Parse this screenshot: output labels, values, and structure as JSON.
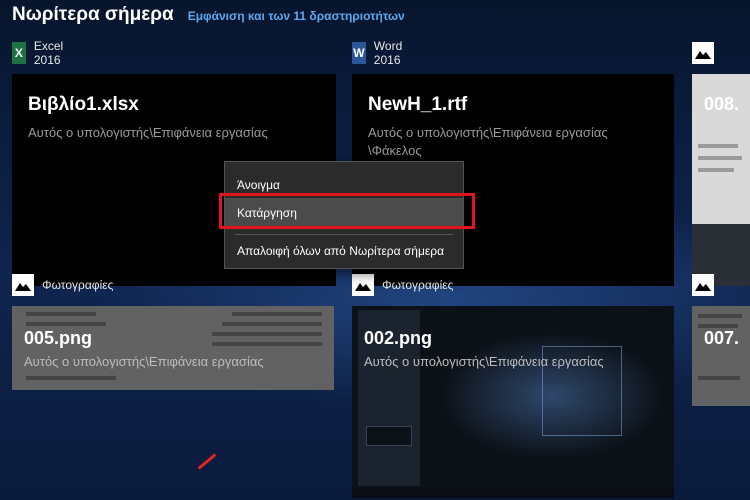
{
  "header": {
    "title": "Νωρίτερα σήμερα",
    "link": "Εμφάνιση και των 11 δραστηριοτήτων"
  },
  "cards": [
    {
      "app": "Excel 2016",
      "app_icon": "excel-icon",
      "title": "Βιβλίο1.xlsx",
      "path": "Αυτός ο υπολογιστής\\Επιφάνεια εργασίας"
    },
    {
      "app": "Word 2016",
      "app_icon": "word-icon",
      "title": "NewH_1.rtf",
      "path_line1": "Αυτός ο υπολογιστής\\Επιφάνεια εργασίας",
      "path_line2": "\\Φάκελος"
    },
    {
      "app": "",
      "app_icon": "photos-icon",
      "title": "008.",
      "path": ""
    },
    {
      "app": "Φωτογραφίες",
      "app_icon": "photos-icon",
      "title": "005.png",
      "path": "Αυτός ο υπολογιστής\\Επιφάνεια εργασίας"
    },
    {
      "app": "Φωτογραφίες",
      "app_icon": "photos-icon",
      "title": "002.png",
      "path": "Αυτός ο υπολογιστής\\Επιφάνεια εργασίας"
    },
    {
      "app": "",
      "app_icon": "photos-icon",
      "title": "007.",
      "path": ""
    }
  ],
  "context_menu": {
    "items": [
      "Άνοιγμα",
      "Κατάργηση",
      "Απαλοιφή όλων από Νωρίτερα σήμερα"
    ],
    "hovered_index": 1
  },
  "colors": {
    "accent_link": "#5fa8f0",
    "highlight": "#e0141c",
    "excel": "#1e7145",
    "word": "#2b579a"
  }
}
